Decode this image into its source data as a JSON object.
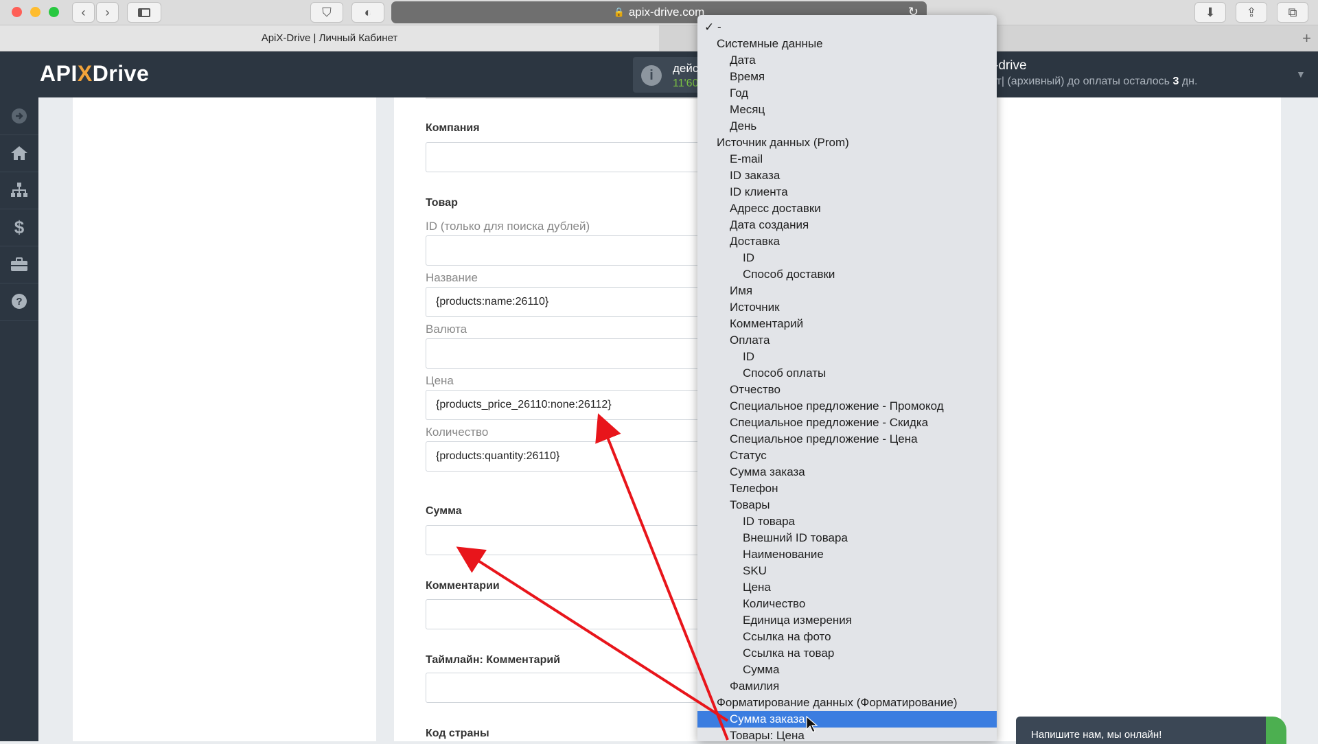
{
  "browser": {
    "url": "apix-drive.com",
    "tab_title": "ApiX-Drive | Личный Кабинет",
    "new_tab": "+"
  },
  "header": {
    "logo_left": "API",
    "logo_x": "X",
    "logo_right": "Drive",
    "info_line1": "дейс",
    "info_line2": "11'60",
    "account_name": "-drive",
    "account_sub_prefix": "от| (архивный) до оплаты осталось",
    "account_days": "3",
    "account_sub_suffix": "дн."
  },
  "sidebar": {
    "items": [
      {
        "icon": "arrow-right-circle-icon"
      },
      {
        "icon": "home-icon"
      },
      {
        "icon": "sitemap-icon"
      },
      {
        "icon": "dollar-icon"
      },
      {
        "icon": "briefcase-icon"
      },
      {
        "icon": "question-circle-icon"
      }
    ]
  },
  "form": {
    "company_label": "Компания",
    "company_value": "",
    "product_section": "Товар",
    "id_label": "ID (только для поиска дублей)",
    "id_value": "",
    "name_label": "Название",
    "name_value": "{products:name:26110}",
    "currency_label": "Валюта",
    "currency_value": "",
    "price_label": "Цена",
    "price_value": "{products_price_26110:none:26112}",
    "qty_label": "Количество",
    "qty_value": "{products:quantity:26110}",
    "sum_label": "Сумма",
    "sum_value": "",
    "comments_label": "Комментарии",
    "comments_value": "",
    "timeline_label": "Таймлайн: Комментарий",
    "timeline_value": "",
    "country_label": "Код страны"
  },
  "dropdown": {
    "items": [
      {
        "label": "✓ -",
        "level": 0
      },
      {
        "label": "Системные данные",
        "level": 1
      },
      {
        "label": "Дата",
        "level": 2
      },
      {
        "label": "Время",
        "level": 2
      },
      {
        "label": "Год",
        "level": 2
      },
      {
        "label": "Месяц",
        "level": 2
      },
      {
        "label": "День",
        "level": 2
      },
      {
        "label": "Источник данных (Prom)",
        "level": 1
      },
      {
        "label": "E-mail",
        "level": 2
      },
      {
        "label": "ID заказа",
        "level": 2
      },
      {
        "label": "ID клиента",
        "level": 2
      },
      {
        "label": "Адресс доставки",
        "level": 2
      },
      {
        "label": "Дата создания",
        "level": 2
      },
      {
        "label": "Доставка",
        "level": 2
      },
      {
        "label": "ID",
        "level": 3
      },
      {
        "label": "Способ доставки",
        "level": 3
      },
      {
        "label": "Имя",
        "level": 2
      },
      {
        "label": "Источник",
        "level": 2
      },
      {
        "label": "Комментарий",
        "level": 2
      },
      {
        "label": "Оплата",
        "level": 2
      },
      {
        "label": "ID",
        "level": 3
      },
      {
        "label": "Способ оплаты",
        "level": 3
      },
      {
        "label": "Отчество",
        "level": 2
      },
      {
        "label": "Специальное предложение - Промокод",
        "level": 2
      },
      {
        "label": "Специальное предложение - Скидка",
        "level": 2
      },
      {
        "label": "Специальное предложение - Цена",
        "level": 2
      },
      {
        "label": "Статус",
        "level": 2
      },
      {
        "label": "Сумма заказа",
        "level": 2
      },
      {
        "label": "Телефон",
        "level": 2
      },
      {
        "label": "Товары",
        "level": 2
      },
      {
        "label": "ID товара",
        "level": 3
      },
      {
        "label": "Внешний ID товара",
        "level": 3
      },
      {
        "label": "Наименование",
        "level": 3
      },
      {
        "label": "SKU",
        "level": 3
      },
      {
        "label": "Цена",
        "level": 3
      },
      {
        "label": "Количество",
        "level": 3
      },
      {
        "label": "Единица измерения",
        "level": 3
      },
      {
        "label": "Ссылка на фото",
        "level": 3
      },
      {
        "label": "Ссылка на товар",
        "level": 3
      },
      {
        "label": "Сумма",
        "level": 3
      },
      {
        "label": "Фамилия",
        "level": 2
      },
      {
        "label": "Форматирование данных (Форматирование)",
        "level": 1
      },
      {
        "label": "Сумма заказа",
        "level": 2,
        "selected": true
      },
      {
        "label": "Товары: Цена",
        "level": 2
      }
    ]
  },
  "chat": {
    "label": "Напишите нам, мы онлайн!"
  },
  "colors": {
    "header_bg": "#2c3641",
    "selection": "#3b7de0",
    "arrow": "#e8151b",
    "accent_orange": "#f2a33a"
  }
}
